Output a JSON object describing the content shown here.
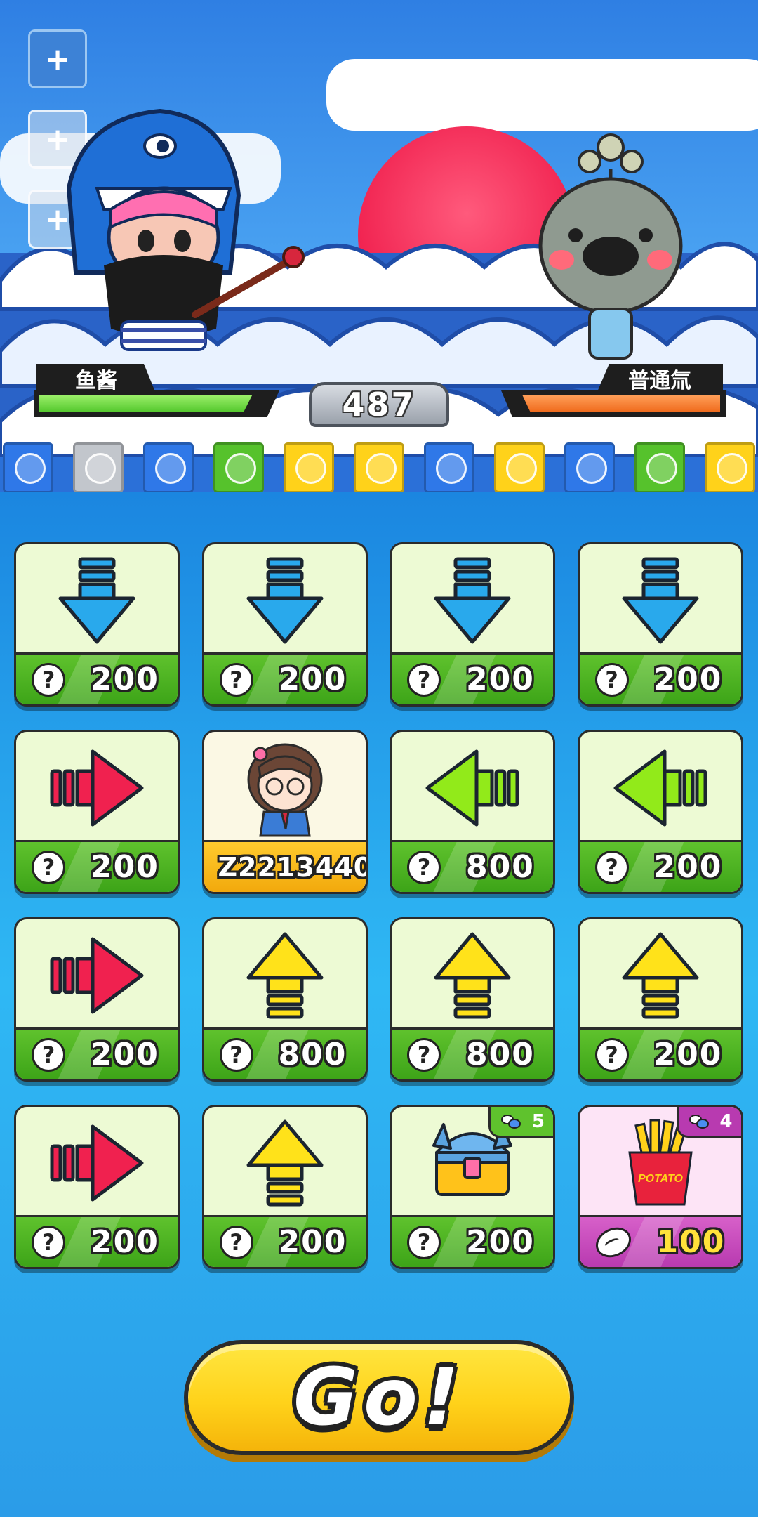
{
  "battle": {
    "player_name": "鱼酱",
    "player_hp": 0.92,
    "enemy_name": "普通氚",
    "enemy_hp": 0.94,
    "score": "487"
  },
  "side_buttons": [
    {
      "icon": "plus-icon",
      "label": "+"
    },
    {
      "icon": "plus-icon",
      "label": "+"
    },
    {
      "icon": "plus-icon",
      "label": "+"
    }
  ],
  "gems": [
    "blue",
    "gray",
    "blue",
    "green",
    "yellow",
    "yellow",
    "blue",
    "yellow",
    "blue",
    "green",
    "yellow"
  ],
  "gem_colors": {
    "blue": "#2f78e8",
    "gray": "#c2c6cc",
    "green": "#56c22c",
    "yellow": "#ffd21a"
  },
  "cards": [
    {
      "type": "arrow",
      "icon": "arrow-down-icon",
      "price": "200"
    },
    {
      "type": "arrow",
      "icon": "arrow-down-icon",
      "price": "200"
    },
    {
      "type": "arrow",
      "icon": "arrow-down-icon",
      "price": "200"
    },
    {
      "type": "arrow",
      "icon": "arrow-down-icon",
      "price": "200"
    },
    {
      "type": "arrow",
      "icon": "arrow-right-icon",
      "price": "200"
    },
    {
      "type": "hero",
      "icon": "girl-avatar-icon",
      "price": "Z2213440"
    },
    {
      "type": "arrow",
      "icon": "arrow-left-icon",
      "price": "800"
    },
    {
      "type": "arrow",
      "icon": "arrow-left-icon",
      "price": "200"
    },
    {
      "type": "arrow",
      "icon": "arrow-right-icon",
      "price": "200"
    },
    {
      "type": "arrow",
      "icon": "arrow-up-icon",
      "price": "800"
    },
    {
      "type": "arrow",
      "icon": "arrow-up-icon",
      "price": "800"
    },
    {
      "type": "arrow",
      "icon": "arrow-up-icon",
      "price": "200"
    },
    {
      "type": "arrow",
      "icon": "arrow-right-icon",
      "price": "200"
    },
    {
      "type": "arrow",
      "icon": "arrow-up-icon",
      "price": "200"
    },
    {
      "type": "item",
      "icon": "treasure-chest-icon",
      "price": "200",
      "badge": "5"
    },
    {
      "type": "item",
      "icon": "french-fries-icon",
      "price": "100",
      "badge": "4",
      "label": "POTATO"
    }
  ],
  "go_button": {
    "label": "Go!"
  }
}
